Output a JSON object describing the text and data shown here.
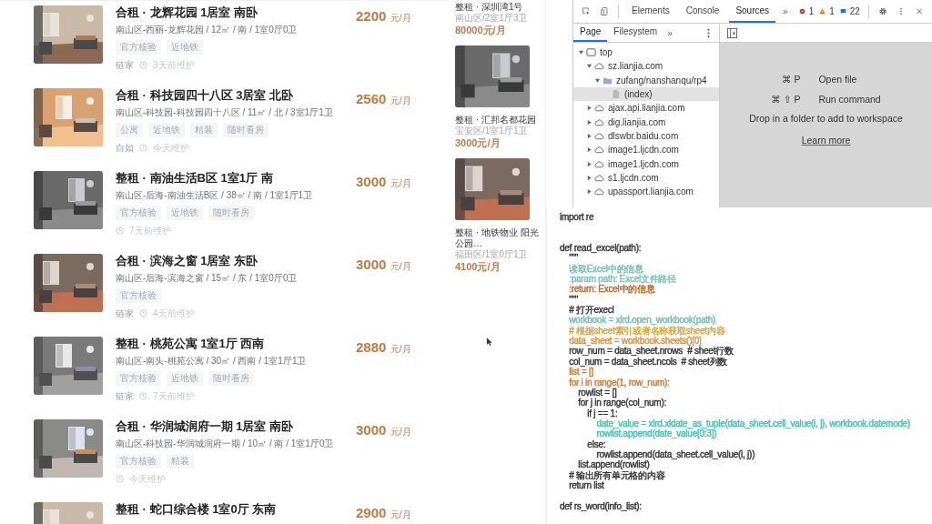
{
  "listings": [
    {
      "title": "合租 · 龙辉花园 1居室 南卧",
      "details": "南山区-西丽-龙辉花园 / 12㎡ / 南 / 1室0厅0卫",
      "tags": [
        "官方核验",
        "近地铁"
      ],
      "source": "链家",
      "maintained": "3天前维护",
      "price": "2200",
      "unit": "元/月"
    },
    {
      "title": "合租 · 科技园四十八区 3居室 北卧",
      "details": "南山区-科技园-科技园四十八区 / 11㎡ / 北 / 3室1厅1卫",
      "tags": [
        "公寓",
        "近地铁",
        "精装",
        "随时看房"
      ],
      "source": "自如",
      "maintained": "今天维护",
      "price": "2560",
      "unit": "元/月"
    },
    {
      "title": "整租 · 南油生活B区 1室1厅 南",
      "details": "南山区-后海-南油生活B区 / 38㎡ / 南 / 1室1厅1卫",
      "tags": [
        "官方核验",
        "近地铁",
        "随时看房"
      ],
      "maintained": "7天前维护",
      "price": "3000",
      "unit": "元/月"
    },
    {
      "title": "合租 · 滨海之窗 1居室 东卧",
      "details": "南山区-后海-滨海之窗 / 15㎡ / 东 / 1室0厅0卫",
      "tags": [
        "官方核验"
      ],
      "source": "链家",
      "maintained": "4天前维护",
      "price": "3000",
      "unit": "元/月"
    },
    {
      "title": "整租 · 桃苑公寓 1室1厅 西南",
      "details": "南山区-南头-桃苑公寓 / 30㎡ / 西南 / 1室1厅1卫",
      "tags": [
        "官方核验",
        "近地铁",
        "随时看房"
      ],
      "source": "链家",
      "maintained": "7天前维护",
      "price": "2880",
      "unit": "元/月"
    },
    {
      "title": "合租 · 华润城润府一期 1居室 南卧",
      "details": "南山区-科技园-华润城润府一期 / 10㎡ / 南 / 1室1厅0卫",
      "tags": [
        "官方核验",
        "精装"
      ],
      "maintained": "今天维护",
      "price": "3000",
      "unit": "元/月"
    },
    {
      "title": "整租 · 蛇口综合楼 1室0厅 东南",
      "price": "2900",
      "unit": "元/月"
    }
  ],
  "recommendations": [
    {
      "title": "整租 · 深圳湾1号",
      "details": "南山区/2室1厅3卫",
      "price": "80000元/月"
    },
    {
      "title": "整租 · 汇邦名都花园",
      "details": "宝安区/1室1厅1卫",
      "price": "3000元/月"
    },
    {
      "title": "整租 · 地铁物业 阳光公园…",
      "details": "福田区/1室0厅1卫",
      "price": "4100元/月"
    }
  ],
  "devtools": {
    "tabs": [
      {
        "label": "Elements",
        "selected": false
      },
      {
        "label": "Console",
        "selected": false
      },
      {
        "label": "Sources",
        "selected": true
      }
    ],
    "more_tabs": "»",
    "errors": "1",
    "warnings": "1",
    "messages": "22",
    "navigator_tabs": [
      {
        "label": "Page",
        "selected": true
      },
      {
        "label": "Filesystem",
        "selected": false
      }
    ],
    "navigator_more": "»",
    "tree": [
      {
        "label": "top",
        "kind": "frame",
        "expanded": true,
        "selected": false,
        "children": [
          {
            "label": "sz.lianjia.com",
            "kind": "domain",
            "expanded": true,
            "selected": false,
            "children": [
              {
                "label": "zufang/nanshanqu/rp4",
                "kind": "folder",
                "expanded": true,
                "selected": false,
                "children": [
                  {
                    "label": "(index)",
                    "kind": "file",
                    "selected": true
                  }
                ]
              }
            ]
          },
          {
            "label": "ajax.api.lianjia.com",
            "kind": "domain",
            "expanded": false,
            "selected": false
          },
          {
            "label": "dig.lianjia.com",
            "kind": "domain",
            "expanded": false,
            "selected": false
          },
          {
            "label": "dlswbr.baidu.com",
            "kind": "domain",
            "expanded": false,
            "selected": false
          },
          {
            "label": "image1.ljcdn.com",
            "kind": "domain",
            "expanded": false,
            "selected": false
          },
          {
            "label": "image1.ljcdn.com",
            "kind": "domain",
            "expanded": false,
            "selected": false
          },
          {
            "label": "s1.ljcdn.com",
            "kind": "domain",
            "expanded": false,
            "selected": false
          },
          {
            "label": "upassport.lianjia.com",
            "kind": "domain",
            "expanded": false,
            "selected": false
          }
        ]
      }
    ],
    "shortcuts": [
      {
        "keys": "⌘ P",
        "action": "Open file"
      },
      {
        "keys": "⌘ ⇧ P",
        "action": "Run command"
      }
    ],
    "drop_hint": "Drop in a folder to add to workspace",
    "learn_more": "Learn more"
  },
  "editor": {
    "lines": [
      {
        "kind": "code",
        "text": "import re",
        "color": "#333333"
      },
      {
        "kind": "blank"
      },
      {
        "kind": "blank"
      },
      {
        "kind": "code",
        "text": "def read_excel(path):",
        "color": "#333333"
      },
      {
        "kind": "code",
        "text": "    \"\"\"",
        "color": "#333333"
      },
      {
        "kind": "code",
        "text": "    读取Excel中的信息",
        "color": "#6fbfb2"
      },
      {
        "kind": "code",
        "text": "    :param path: Excel文件路径",
        "color": "#78c2b6"
      },
      {
        "kind": "code",
        "text": "    :return: Excel中的信息",
        "color": "#c0651a"
      },
      {
        "kind": "code",
        "text": "    \"\"\"",
        "color": "#333333"
      },
      {
        "kind": "code",
        "text": "    # 打开execl",
        "color": "#333333"
      },
      {
        "kind": "code",
        "text": "    workbook = xlrd.open_workbook(path)",
        "color": "#6cbcaf"
      },
      {
        "kind": "code",
        "text": "    # 根据sheet索引或者名称获取sheet内容",
        "color": "#e0a030"
      },
      {
        "kind": "code",
        "text": "    data_sheet = workbook.sheets()[0]",
        "color": "#d8903a"
      },
      {
        "kind": "code",
        "text": "    row_num = data_sheet.nrows  # sheet行数",
        "color": "#333333"
      },
      {
        "kind": "code",
        "text": "    col_num = data_sheet.ncols  # sheet列数",
        "color": "#333333"
      },
      {
        "kind": "code",
        "text": "    list = []",
        "color": "#d07a30"
      },
      {
        "kind": "code",
        "text": "    for i in range(1, row_num):",
        "color": "#d07a30"
      },
      {
        "kind": "code",
        "text": "        rowlist = []",
        "color": "#333333"
      },
      {
        "kind": "code",
        "text": "        for j in range(col_num):",
        "color": "#333333"
      },
      {
        "kind": "code",
        "text": "            if j == 1:",
        "color": "#333333"
      },
      {
        "kind": "code",
        "text": "                date_value = xlrd.xldate_as_tuple(data_sheet.cell_value(i, j), workbook.datemode)",
        "color": "#3cc4b0"
      },
      {
        "kind": "code",
        "text": "                rowlist.append(date_value[0:3])",
        "color": "#3cc4b0"
      },
      {
        "kind": "code",
        "text": "            else:",
        "color": "#333333"
      },
      {
        "kind": "code",
        "text": "                rowlist.append(data_sheet.cell_value(i, j))",
        "color": "#333333"
      },
      {
        "kind": "code",
        "text": "        list.append(rowlist)",
        "color": "#333333"
      },
      {
        "kind": "code",
        "text": "    # 输出所有单元格的内容",
        "color": "#333333"
      },
      {
        "kind": "code",
        "text": "    return list",
        "color": "#333333"
      },
      {
        "kind": "blank"
      },
      {
        "kind": "code",
        "text": "def rs_word(info_list):",
        "color": "#333333"
      }
    ]
  }
}
